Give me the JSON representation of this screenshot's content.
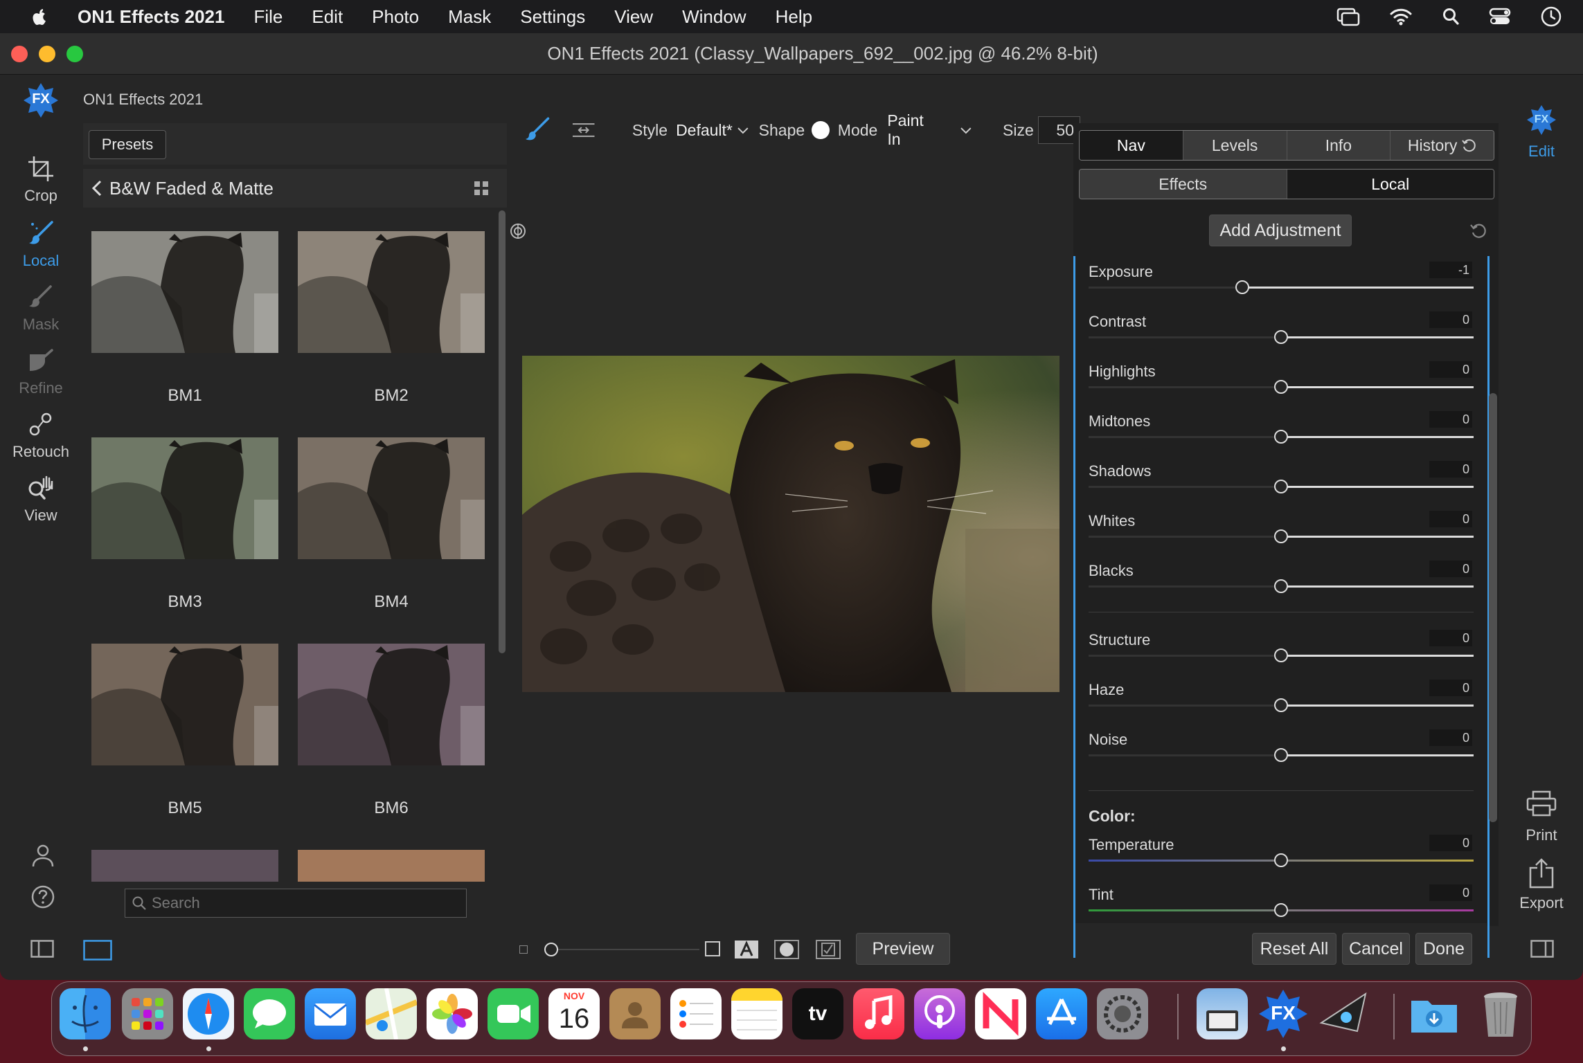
{
  "menubar": {
    "app_name": "ON1 Effects 2021",
    "items": [
      "File",
      "Edit",
      "Photo",
      "Mask",
      "Settings",
      "View",
      "Window",
      "Help"
    ]
  },
  "window": {
    "title": "ON1 Effects 2021 (Classy_Wallpapers_692__002.jpg @ 46.2% 8-bit)",
    "app_label": "ON1 Effects 2021",
    "logo_text": "FX"
  },
  "tools": {
    "crop": "Crop",
    "local": "Local",
    "mask": "Mask",
    "refine": "Refine",
    "retouch": "Retouch",
    "view": "View"
  },
  "right_modules": {
    "edit_logo": "FX",
    "edit": "Edit",
    "print": "Print",
    "export": "Export"
  },
  "presets": {
    "button": "Presets",
    "category": "B&W Faded & Matte",
    "items": [
      "BM1",
      "BM2",
      "BM3",
      "BM4",
      "BM5",
      "BM6"
    ],
    "search_placeholder": "Search"
  },
  "brush_toolbar": {
    "style_label": "Style",
    "style_value": "Default*",
    "shape_label": "Shape",
    "mode_label": "Mode",
    "mode_value": "Paint In",
    "size_label": "Size",
    "size_value": "50"
  },
  "panel": {
    "tabs": [
      "Nav",
      "Levels",
      "Info",
      "History"
    ],
    "subtabs": [
      "Effects",
      "Local"
    ],
    "add_adjustment": "Add Adjustment",
    "sliders_tone": [
      {
        "label": "Exposure",
        "value": "-1",
        "level": 0.4
      },
      {
        "label": "Contrast",
        "value": "0",
        "level": 0.5
      },
      {
        "label": "Highlights",
        "value": "0",
        "level": 0.5
      },
      {
        "label": "Midtones",
        "value": "0",
        "level": 0.5
      },
      {
        "label": "Shadows",
        "value": "0",
        "level": 0.5
      },
      {
        "label": "Whites",
        "value": "0",
        "level": 0.5
      },
      {
        "label": "Blacks",
        "value": "0",
        "level": 0.5
      }
    ],
    "sliders_detail": [
      {
        "label": "Structure",
        "value": "0",
        "level": 0.5
      },
      {
        "label": "Haze",
        "value": "0",
        "level": 0.5
      },
      {
        "label": "Noise",
        "value": "0",
        "level": 0.5
      }
    ],
    "color_heading": "Color:",
    "sliders_color": [
      {
        "label": "Temperature",
        "value": "0",
        "level": 0.5
      },
      {
        "label": "Tint",
        "value": "0",
        "level": 0.5
      }
    ]
  },
  "bottom": {
    "preview": "Preview",
    "reset_all": "Reset All",
    "cancel": "Cancel",
    "done": "Done"
  },
  "dock": {
    "calendar_month": "NOV",
    "calendar_day": "16",
    "tv_label": "tv",
    "fx_label": "FX"
  },
  "colors": {
    "accent": "#3d9ce8",
    "wallpaper": "#5a1420"
  }
}
